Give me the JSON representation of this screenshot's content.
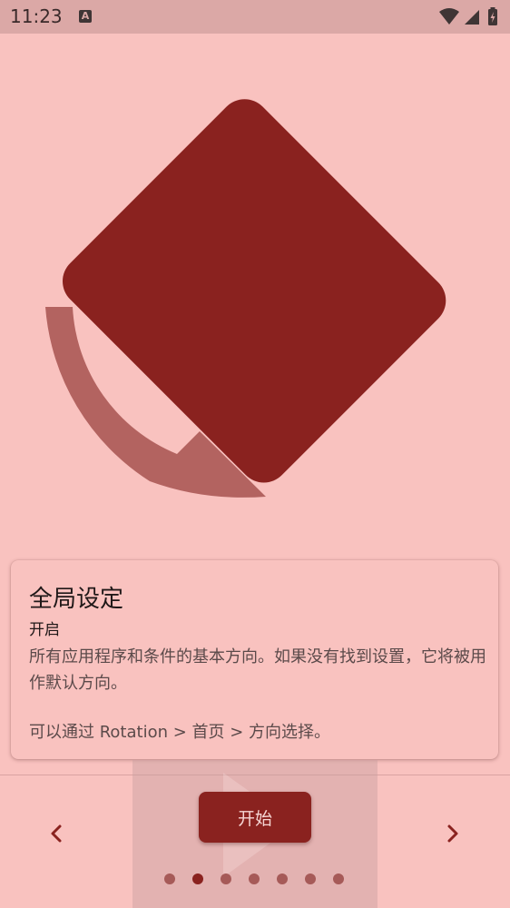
{
  "status_bar": {
    "time": "11:23",
    "notification_icon": "a-icon",
    "notification_letter": "A",
    "icons": [
      "wifi-icon",
      "cellular-signal-icon",
      "battery-charging-icon"
    ]
  },
  "illustration": {
    "icon": "screen-rotation-icon"
  },
  "card": {
    "title": "全局设定",
    "status": "开启",
    "description": "所有应用程序和条件的基本方向。如果没有找到设置，它将被用作默认方向。",
    "hint": "可以通过 Rotation > 首页 > 方向选择。"
  },
  "bottom_bar": {
    "start_label": "开始",
    "prev_icon": "chevron-left-icon",
    "next_icon": "chevron-right-icon",
    "page_count": 7,
    "active_page_index": 1
  },
  "colors": {
    "background": "#f9c2bf",
    "accent": "#8a221f",
    "arrow": "#b36360",
    "status_bar": "#dba8a6"
  }
}
